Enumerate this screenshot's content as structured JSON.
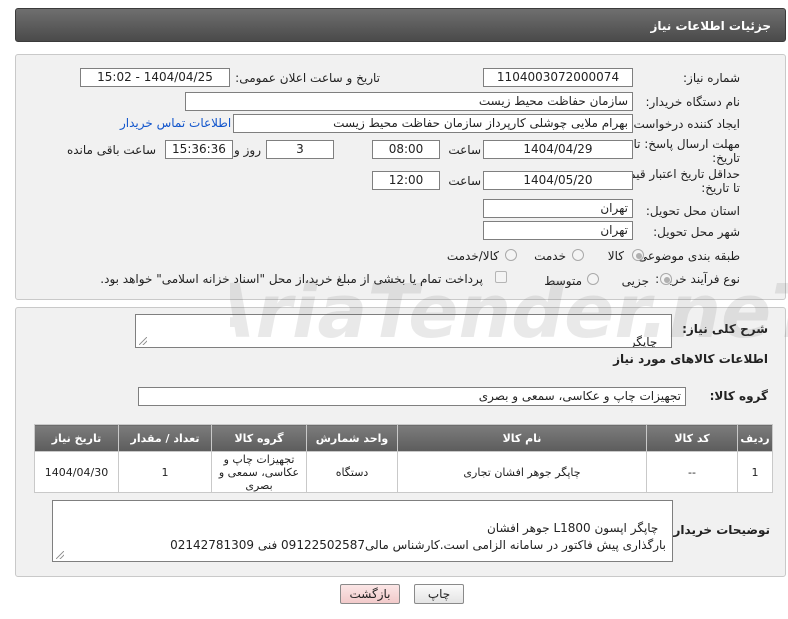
{
  "header": {
    "title": "جزئیات اطلاعات نیاز"
  },
  "form": {
    "need_number_label": "شماره نیاز:",
    "need_number": "1104003072000074",
    "announce_label": "تاریخ و ساعت اعلان عمومی:",
    "announce_value": "1404/04/25 - 15:02",
    "buyer_org_label": "نام دستگاه خریدار:",
    "buyer_org": "سازمان حفاظت محیط زیست",
    "requester_label": "ایجاد کننده درخواست:",
    "requester": "بهرام ملایی چوشلی کارپرداز سازمان حفاظت محیط زیست",
    "contact_link": "اطلاعات تماس خریدار",
    "deadline_label_1": "مهلت ارسال پاسخ: تا",
    "deadline_label_2": "تاریخ:",
    "deadline_date": "1404/04/29",
    "time_label": "ساعت",
    "deadline_time": "08:00",
    "days_value": "3",
    "days_label": "روز و",
    "remaining_time": "15:36:36",
    "remaining_label": "ساعت باقی مانده",
    "validity_label_1": "حداقل تاریخ اعتبار قیمت:",
    "validity_label_2": "تا تاریخ:",
    "validity_date": "1404/05/20",
    "validity_time_label": "ساعت",
    "validity_time": "12:00",
    "province_label": "استان محل تحویل:",
    "province": "تهران",
    "city_label": "شهر محل تحویل:",
    "city": "تهران",
    "category_label": "طبقه بندی موضوعی:",
    "category_options": [
      "کالا",
      "خدمت",
      "کالا/خدمت"
    ],
    "process_label": "نوع فرآیند خرید :",
    "process_options": [
      "جزیی",
      "متوسط"
    ],
    "payment_note": "پرداخت تمام یا بخشی از مبلغ خرید،از محل \"اسناد خزانه اسلامی\" خواهد بود."
  },
  "description": {
    "label": "شرح کلی نیاز:",
    "value": "چاپگر"
  },
  "goods_section_title": "اطلاعات کالاهای مورد نیاز",
  "goods_group": {
    "label": "گروه کالا:",
    "value": "تجهیزات چاپ و عکاسی، سمعی و بصری"
  },
  "table": {
    "headers": [
      "ردیف",
      "کد کالا",
      "نام کالا",
      "واحد شمارش",
      "گروه کالا",
      "تعداد / مقدار",
      "تاریخ نیاز"
    ],
    "rows": [
      [
        "1",
        "--",
        "چاپگر جوهر افشان تجاری",
        "دستگاه",
        "تجهیزات چاپ و عکاسی، سمعی و بصری",
        "1",
        "1404/04/30"
      ]
    ]
  },
  "buyer_notes": {
    "label": "توضیحات خریدار:",
    "value": "چاپگر اپسون L1800 جوهر افشان\nبارگذاری پیش فاکتور در سامانه الزامی است.کارشناس مالی09122502587 فنی 02142781309"
  },
  "buttons": {
    "print": "چاپ",
    "back": "بازگشت"
  },
  "watermark": "AriaTender.neT",
  "colors": {
    "header_bg": "#5a5a5a",
    "panel_bg": "#f1f1f1",
    "link": "#1155cc",
    "back_button_bg": "#f7d7d7"
  }
}
